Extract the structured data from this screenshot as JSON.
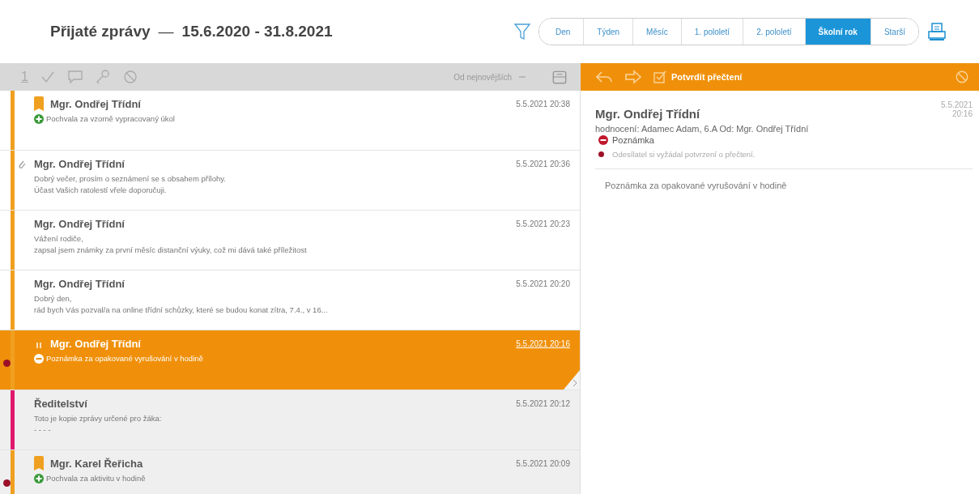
{
  "header": {
    "title": "Přijaté zprávy",
    "separator": "—",
    "range": "15.6.2020 - 31.8.2021"
  },
  "periods": [
    {
      "label": "Den",
      "selected": false
    },
    {
      "label": "Týden",
      "selected": false
    },
    {
      "label": "Měsíc",
      "selected": false
    },
    {
      "label": "1. pololetí",
      "selected": false
    },
    {
      "label": "2. pololetí",
      "selected": false
    },
    {
      "label": "Školní rok",
      "selected": true
    },
    {
      "label": "Starší",
      "selected": false
    }
  ],
  "list_toolbar": {
    "counter": "1",
    "sort": "Od nejnovějších"
  },
  "messages": [
    {
      "sender": "Mgr. Ondřej Třídní",
      "date": "5.5.2021 20:38",
      "lines": [
        "Pochvala za vzorně vypracovaný úkol"
      ],
      "kind": "plus",
      "tag": true,
      "attachment": false,
      "unread": false,
      "selected": false,
      "read": false,
      "color": "#f0a020"
    },
    {
      "sender": "Mgr. Ondřej Třídní",
      "date": "5.5.2021 20:36",
      "lines": [
        "Dobrý večer, prosím o seznámení se s obsahem přílohy.",
        "Účast Vašich ratolestí vřele doporučuji."
      ],
      "kind": "plain",
      "tag": false,
      "attachment": true,
      "unread": false,
      "selected": false,
      "read": false,
      "color": "#f0a020"
    },
    {
      "sender": "Mgr. Ondřej Třídní",
      "date": "5.5.2021 20:23",
      "lines": [
        "Vážení rodiče,",
        "zapsal jsem známky za první měsíc distanční výuky, což mi dává také příležitost"
      ],
      "kind": "plain",
      "tag": false,
      "attachment": false,
      "unread": false,
      "selected": false,
      "read": false,
      "color": "#f0a020"
    },
    {
      "sender": "Mgr. Ondřej Třídní",
      "date": "5.5.2021 20:20",
      "lines": [
        "Dobrý den,",
        "rád bych Vás pozval/a na online třídní schůzky, které se budou konat zítra, 7.4., v 16..."
      ],
      "kind": "plain",
      "tag": false,
      "attachment": false,
      "unread": false,
      "selected": false,
      "read": false,
      "color": "#f0a020"
    },
    {
      "sender": "Mgr. Ondřej Třídní",
      "date": "5.5.2021 20:16",
      "lines": [
        "Poznámka za opakované vyrušování v hodině"
      ],
      "kind": "minus",
      "tag": true,
      "attachment": false,
      "unread": true,
      "selected": true,
      "read": false,
      "color": "#f0a020"
    },
    {
      "sender": "Ředitelství",
      "date": "5.5.2021 20:12",
      "lines": [
        "Toto je kopie zprávy určené pro žáka:",
        "- - - -"
      ],
      "kind": "plain",
      "tag": false,
      "attachment": false,
      "unread": false,
      "selected": false,
      "read": true,
      "color": "#e0186c"
    },
    {
      "sender": "Mgr. Karel Řeřicha",
      "date": "5.5.2021 20:09",
      "lines": [
        "Pochvala za aktivitu v hodině"
      ],
      "kind": "plus",
      "tag": true,
      "attachment": false,
      "unread": true,
      "selected": false,
      "read": true,
      "color": "#f0a020"
    }
  ],
  "detail_toolbar": {
    "confirm": "Potvrdit přečtení"
  },
  "detail": {
    "sender": "Mgr. Ondřej Třídní",
    "date": "5.5.2021",
    "time": "20:16",
    "meta": "hodnocení: Adamec Adam, 6.A Od: Mgr. Ondřej Třídní",
    "kind": "minus",
    "eval_label": "Poznámka",
    "notice": "Odesílatel si vyžádal potvrzení o přečtení.",
    "body": "Poznámka za opakované vyrušování v hodině"
  }
}
